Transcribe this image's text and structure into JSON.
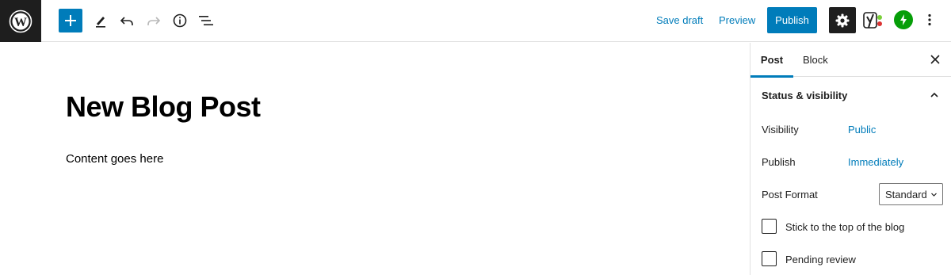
{
  "toolbar": {
    "logo_icon": "wordpress-icon",
    "add_icon": "plus-icon",
    "tools_icon": "pencil-icon",
    "undo_icon": "undo-icon",
    "redo_icon": "redo-icon",
    "info_icon": "info-icon",
    "outline_icon": "list-view-icon",
    "save_draft_label": "Save draft",
    "preview_label": "Preview",
    "publish_label": "Publish",
    "settings_icon": "gear-icon",
    "yoast_icon": "yoast-icon",
    "jetpack_icon": "jetpack-icon",
    "more_icon": "more-vertical-icon",
    "accent_color": "#007cba"
  },
  "editor": {
    "title": "New Blog Post",
    "content": "Content goes here"
  },
  "sidebar": {
    "tabs": [
      {
        "label": "Post",
        "active": true
      },
      {
        "label": "Block",
        "active": false
      }
    ],
    "close_icon": "close-icon",
    "panel": {
      "title": "Status & visibility",
      "expanded": true,
      "visibility_label": "Visibility",
      "visibility_value": "Public",
      "publish_label": "Publish",
      "publish_value": "Immediately",
      "post_format_label": "Post Format",
      "post_format_value": "Standard",
      "sticky_label": "Stick to the top of the blog",
      "sticky_checked": false,
      "pending_label": "Pending review",
      "pending_checked": false
    }
  }
}
